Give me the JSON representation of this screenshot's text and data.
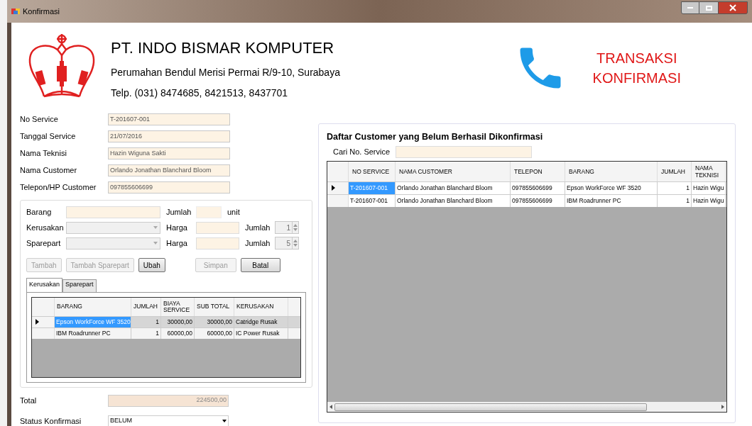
{
  "window": {
    "title": "Konfirmasi"
  },
  "header": {
    "company": "PT. INDO BISMAR KOMPUTER",
    "address": "Perumahan Bendul Merisi Permai R/9-10, Surabaya",
    "phone": "Telp. (031) 8474685, 8421513, 8437701",
    "title_lines": [
      "TRANSAKSI",
      "KONFIRMASI"
    ]
  },
  "fields": [
    {
      "label": "No Service",
      "value": "T-201607-001"
    },
    {
      "label": "Tanggal Service",
      "value": "21/07/2016"
    },
    {
      "label": "Nama Teknisi",
      "value": "Hazin Wiguna Sakti"
    },
    {
      "label": "Nama Customer",
      "value": "Orlando Jonathan Blanchard Bloom"
    },
    {
      "label": "Telepon/HP Customer",
      "value": "097855606699"
    }
  ],
  "entry": {
    "barang_label": "Barang",
    "jumlah_label": "Jumlah",
    "unit": "unit",
    "rows": [
      {
        "label": "Kerusakan",
        "price_label": "Harga",
        "qty_label": "Jumlah",
        "qty": "1",
        "disabled": true
      },
      {
        "label": "Sparepart",
        "price_label": "Harga",
        "qty_label": "Jumlah",
        "qty": "5",
        "disabled": true
      }
    ]
  },
  "buttons": [
    {
      "label": "Tambah",
      "disabled": true
    },
    {
      "label": "Tambah Sparepart",
      "disabled": true
    },
    {
      "label": "Ubah",
      "disabled": false
    },
    {
      "label": "Simpan",
      "disabled": true
    },
    {
      "label": "Batal",
      "disabled": false
    }
  ],
  "tabs": [
    {
      "label": "Kerusakan",
      "selected": true
    },
    {
      "label": "Sparepart",
      "selected": false
    }
  ],
  "detail_table": {
    "columns": [
      "BARANG",
      "JUMLAH",
      "BIAYA SERVICE",
      "SUB TOTAL",
      "KERUSAKAN"
    ],
    "rows": [
      {
        "selected": true,
        "cells": [
          "Epson WorkForce WF 3520",
          "1",
          "30000,00",
          "30000,00",
          "Catridge Rusak"
        ]
      },
      {
        "selected": false,
        "cells": [
          "IBM Roadrunner PC",
          "1",
          "60000,00",
          "60000,00",
          "IC Power Rusak"
        ]
      }
    ]
  },
  "total": {
    "label": "Total",
    "value": "224500,00"
  },
  "status": {
    "label": "Status Konfirmasi",
    "value": "BELUM"
  },
  "customer_panel": {
    "title": "Daftar Customer yang Belum Berhasil Dikonfirmasi",
    "search_label": "Cari No. Service",
    "columns": [
      "NO SERVICE",
      "NAMA CUSTOMER",
      "TELEPON",
      "BARANG",
      "JUMLAH",
      "NAMA TEKNISI"
    ],
    "rows": [
      {
        "selected": true,
        "cells": [
          "T-201607-001",
          "Orlando Jonathan Blanchard Bloom",
          "097855606699",
          "Epson WorkForce WF 3520",
          "1",
          "Hazin Wigu"
        ]
      },
      {
        "selected": false,
        "cells": [
          "T-201607-001",
          "Orlando Jonathan Blanchard Bloom",
          "097855606699",
          "IBM Roadrunner PC",
          "1",
          "Hazin Wigu"
        ]
      }
    ]
  }
}
